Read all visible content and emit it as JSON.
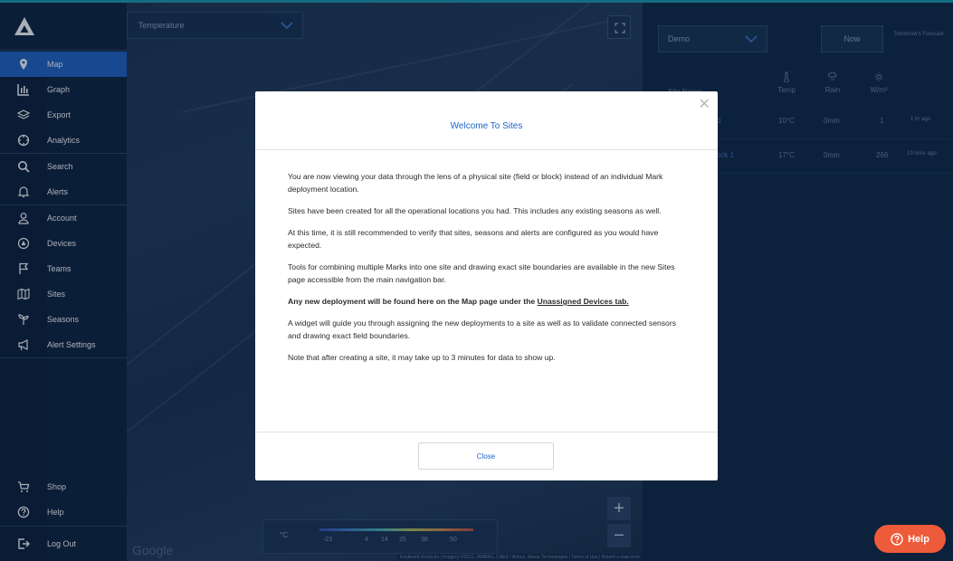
{
  "sidebar": {
    "items": [
      {
        "label": "Map",
        "icon": "map-pin-icon",
        "active": true
      },
      {
        "label": "Graph",
        "icon": "bar-chart-icon"
      },
      {
        "label": "Export",
        "icon": "layers-icon"
      },
      {
        "label": "Analytics",
        "icon": "crosshair-icon"
      },
      {
        "label": "Search",
        "icon": "search-icon"
      },
      {
        "label": "Alerts",
        "icon": "bell-icon"
      },
      {
        "label": "Account",
        "icon": "user-icon"
      },
      {
        "label": "Devices",
        "icon": "device-icon"
      },
      {
        "label": "Teams",
        "icon": "flag-icon"
      },
      {
        "label": "Sites",
        "icon": "folded-map-icon"
      },
      {
        "label": "Seasons",
        "icon": "sprout-icon"
      },
      {
        "label": "Alert Settings",
        "icon": "megaphone-icon"
      }
    ],
    "bottom": [
      {
        "label": "Shop",
        "icon": "cart-icon"
      },
      {
        "label": "Help",
        "icon": "help-circle-icon"
      },
      {
        "label": "Log Out",
        "icon": "logout-icon"
      }
    ]
  },
  "map": {
    "layer_select": "Temperature",
    "legend_unit": "°C",
    "legend_ticks": [
      "-23",
      "4",
      "14",
      "25",
      "38",
      "50"
    ],
    "google": "Google",
    "attribution": "Keyboard shortcuts | Imagery ©2021 , AMBAG, CNES / Airbus, Maxar Technologies | Terms of Use | Report a map error",
    "zoom_in": "+",
    "zoom_out": "−"
  },
  "panel": {
    "demo_select": "Demo",
    "now": "Now",
    "tomorrow": "Tomorrow's Forecast",
    "site_name": "Site Name",
    "cols": [
      "Temp",
      "Rain",
      "W/m²"
    ],
    "rows": [
      {
        "name": "ld",
        "temp": "10°C",
        "rain": "0mm",
        "wm": "1",
        "ago": "1 hr ago"
      },
      {
        "name": "lock 1",
        "temp": "17°C",
        "rain": "0mm",
        "wm": "266",
        "ago": "10 mins ago"
      }
    ]
  },
  "modal": {
    "title": "Welcome To Sites",
    "p1": "You are now viewing your data through the lens of a physical site (field or block) instead of an individual Mark deployment location.",
    "p2": "Sites have been created for all the operational locations you had. This includes any existing seasons as well.",
    "p3": "At this time, it is still recommended to verify that sites, seasons and alerts are configured as you would have expected.",
    "p4": "Tools for combining multiple Marks into one site and drawing exact site boundaries are available in the new Sites page accessible from the main navigation bar.",
    "p5_prefix": "Any new deployment will be found here on the Map page under the ",
    "p5_link": "Unassigned Devices tab.",
    "p6": "A widget will guide you through assigning the new deployments to a site as well as to validate connected sensors and drawing exact field boundaries.",
    "p7": "Note that after creating a site, it may take up to 3 minutes for data to show up.",
    "close_label": "Close"
  },
  "help_button": "Help",
  "colors": {
    "accent": "#1f63c6",
    "help": "#ee5b3a",
    "sidebar": "#0d2240"
  }
}
